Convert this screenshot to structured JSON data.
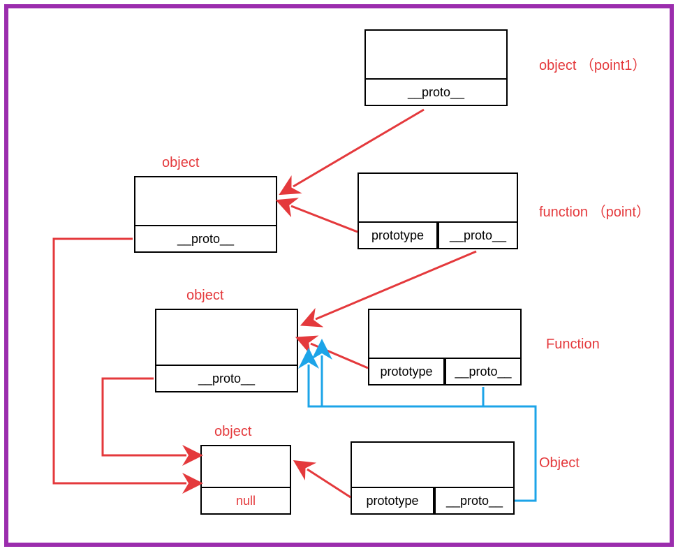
{
  "boxes": {
    "point1": {
      "proto": "__proto__",
      "label": "object （point1）"
    },
    "object1": {
      "title": "object",
      "proto": "__proto__"
    },
    "point": {
      "prototype": "prototype",
      "proto": "__proto__",
      "label": "function （point）"
    },
    "object2": {
      "title": "object",
      "proto": "__proto__"
    },
    "function_ctor": {
      "prototype": "prototype",
      "proto": "__proto__",
      "label": "Function"
    },
    "object3": {
      "title": "object",
      "null": "null"
    },
    "object_ctor": {
      "prototype": "prototype",
      "proto": "__proto__",
      "label": "Object"
    }
  },
  "colors": {
    "red": "#e4393c",
    "blue": "#1ca4e8",
    "border": "#9b2dad"
  }
}
